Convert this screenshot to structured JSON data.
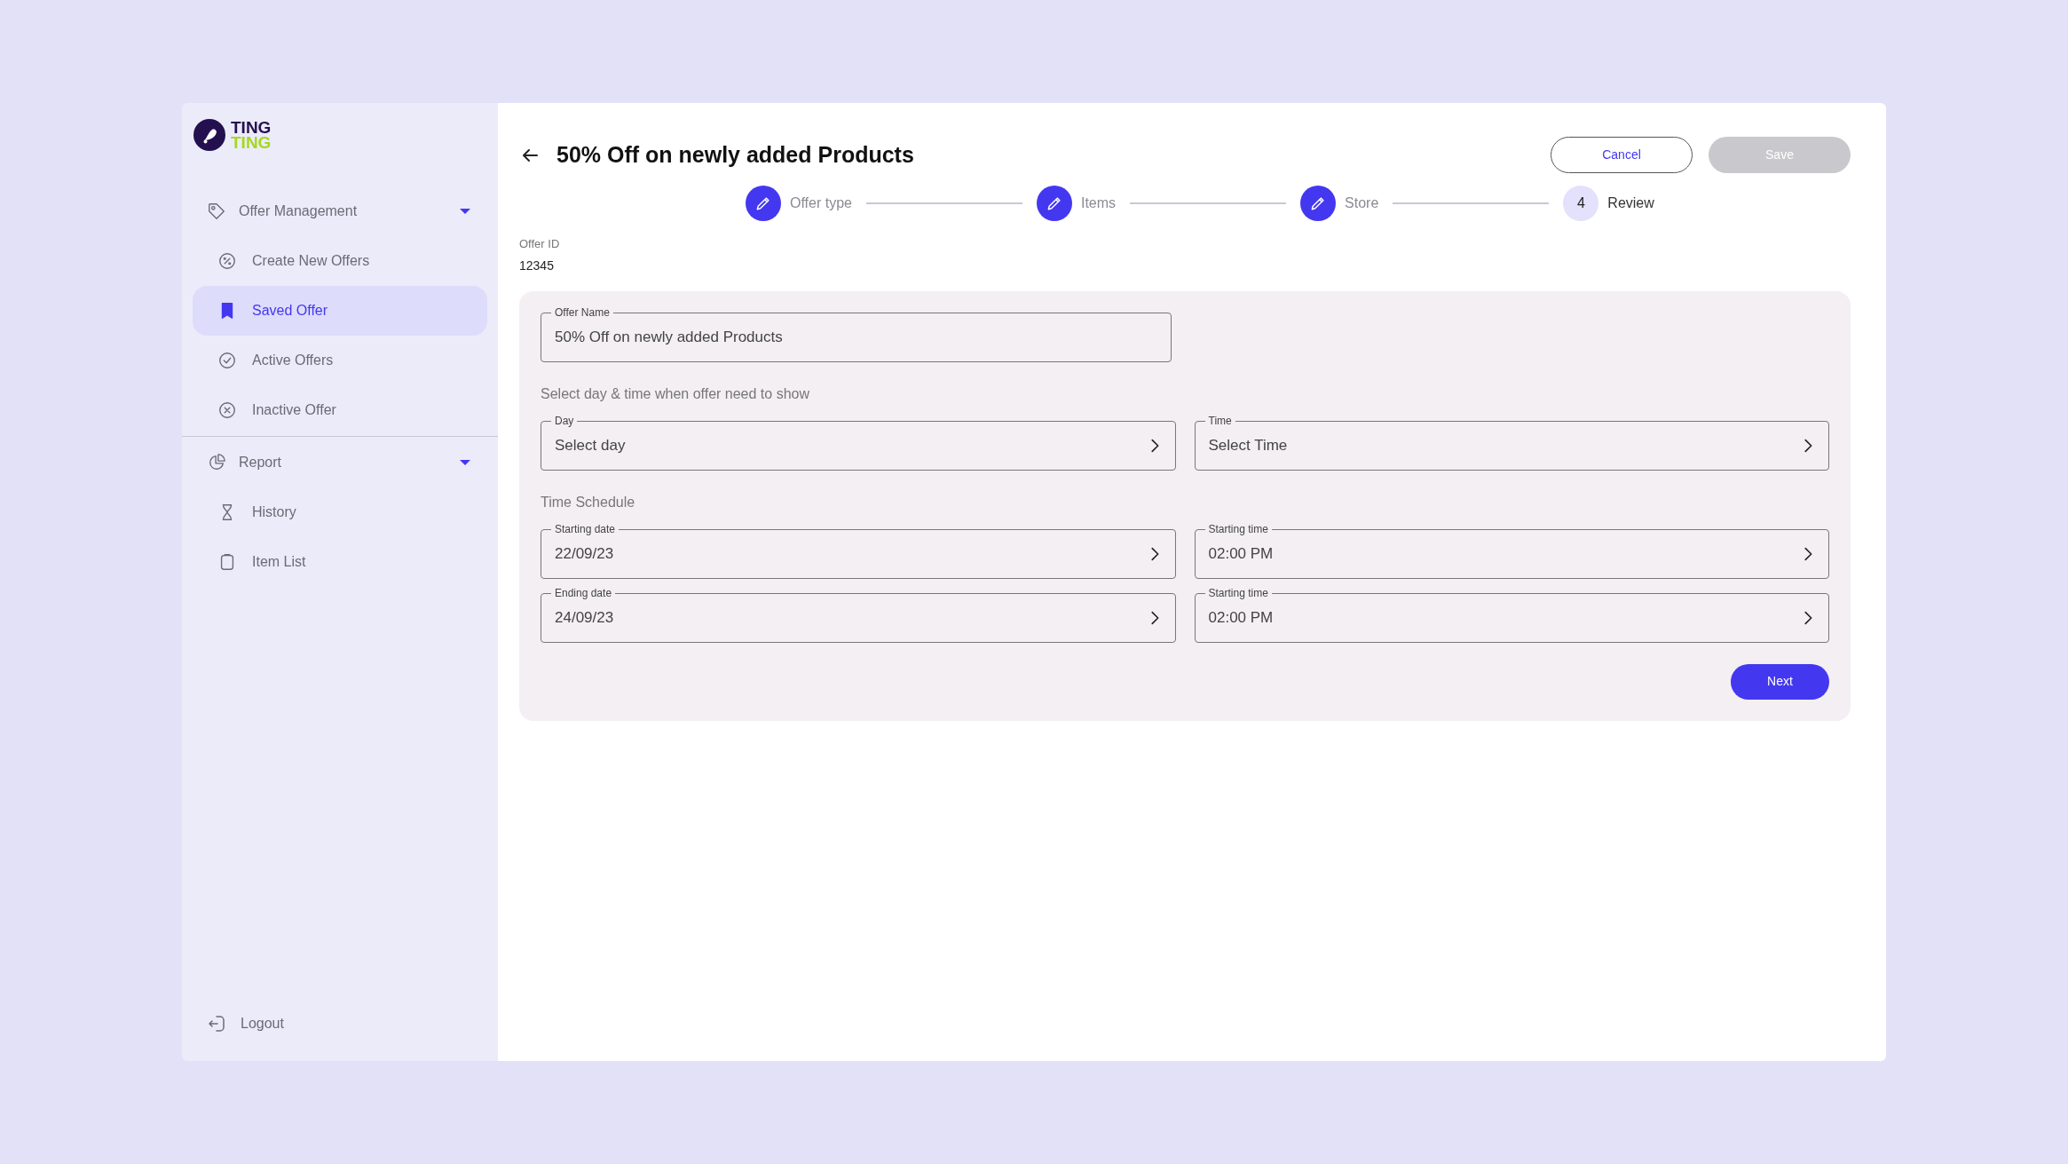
{
  "logo": {
    "line_1": "TING",
    "line_2": "TING"
  },
  "sidebar": {
    "groups": [
      {
        "label": "Offer Management",
        "expanded": true,
        "items": [
          {
            "label": "Create New Offers",
            "selected": false
          },
          {
            "label": "Saved Offer",
            "selected": true
          },
          {
            "label": "Active Offers",
            "selected": false
          },
          {
            "label": "Inactive Offer",
            "selected": false
          }
        ]
      },
      {
        "label": "Report",
        "expanded": true,
        "items": [
          {
            "label": "History",
            "selected": false
          },
          {
            "label": "Item List",
            "selected": false
          }
        ]
      }
    ],
    "logout": "Logout"
  },
  "header": {
    "title": "50% Off on newly added Products",
    "cancel": "Cancel",
    "save": {
      "label": "Save",
      "disabled": true
    }
  },
  "stepper": [
    {
      "label": "Offer type",
      "kind": "done"
    },
    {
      "label": "Items",
      "kind": "done"
    },
    {
      "label": "Store",
      "kind": "done"
    },
    {
      "label": "Review",
      "kind": "pending",
      "number": "4"
    }
  ],
  "offer_id": {
    "label": "Offer ID",
    "value": "12345"
  },
  "form": {
    "offer_name": {
      "label": "Offer Name",
      "value": "50% Off on newly added Products"
    },
    "sections": [
      {
        "heading": "Select day & time when offer need to show",
        "rows": [
          [
            {
              "label": "Day",
              "value": "Select day"
            },
            {
              "label": "Time",
              "value": "Select Time"
            }
          ]
        ]
      },
      {
        "heading": "Time Schedule",
        "rows": [
          [
            {
              "label": "Starting date",
              "value": "22/09/23"
            },
            {
              "label": "Starting time",
              "value": "02:00 PM"
            }
          ],
          [
            {
              "label": "Ending date",
              "value": "24/09/23"
            },
            {
              "label": "Starting time",
              "value": "02:00 PM"
            }
          ]
        ]
      }
    ],
    "next": "Next"
  }
}
